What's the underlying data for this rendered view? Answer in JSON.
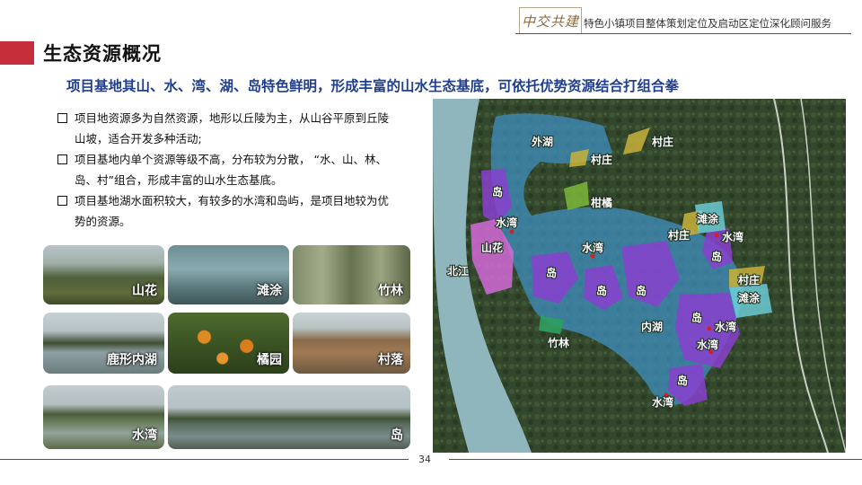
{
  "header": {
    "logo_text": "中交共建",
    "project_title": "特色小镇项目整体策划定位及启动区定位深化顾问服务"
  },
  "title": "生态资源概况",
  "subtitle": "项目基地其山、水、湾、湖、岛特色鲜明，形成丰富的山水生态基底，可依托优势资源结合打组合拳",
  "bullets": [
    "项目地资源多为自然资源，地形以丘陵为主，从山谷平原到丘陵山坡，适合开发多种活动;",
    "项目基地内单个资源等级不高，分布较为分散，  “水、山、林、岛、村”组合，形成丰富的山水生态基底。",
    "项目基地湖水面积较大，有较多的水湾和岛屿，是项目地较为优势的资源。"
  ],
  "photos": [
    {
      "label": "山花"
    },
    {
      "label": "滩涂"
    },
    {
      "label": "竹林"
    },
    {
      "label": "鹿形内湖"
    },
    {
      "label": "橘园"
    },
    {
      "label": "村落"
    },
    {
      "label": "水湾"
    },
    {
      "label": "岛"
    }
  ],
  "map_labels": {
    "waihu": "外湖",
    "cunzhuang1": "村庄",
    "cunzhuang2": "村庄",
    "cunzhuang3": "村庄",
    "cunzhuang4": "村庄",
    "ganju": "柑橘",
    "dao1": "岛",
    "shuiwan1": "水湾",
    "shanhua": "山花",
    "shuiwan2": "水湾",
    "beijiang": "北江",
    "dao2": "岛",
    "dao3": "岛",
    "dao4": "岛",
    "tantu1": "滩涂",
    "shuiwan3": "水湾",
    "dao5": "岛",
    "tantu2": "滩涂",
    "neihu": "内湖",
    "zhulin": "竹林",
    "dao6": "岛",
    "shuiwan4": "水湾",
    "shuiwan5": "水湾",
    "dao7": "岛",
    "shuiwan6": "水湾"
  },
  "page_number": "34"
}
